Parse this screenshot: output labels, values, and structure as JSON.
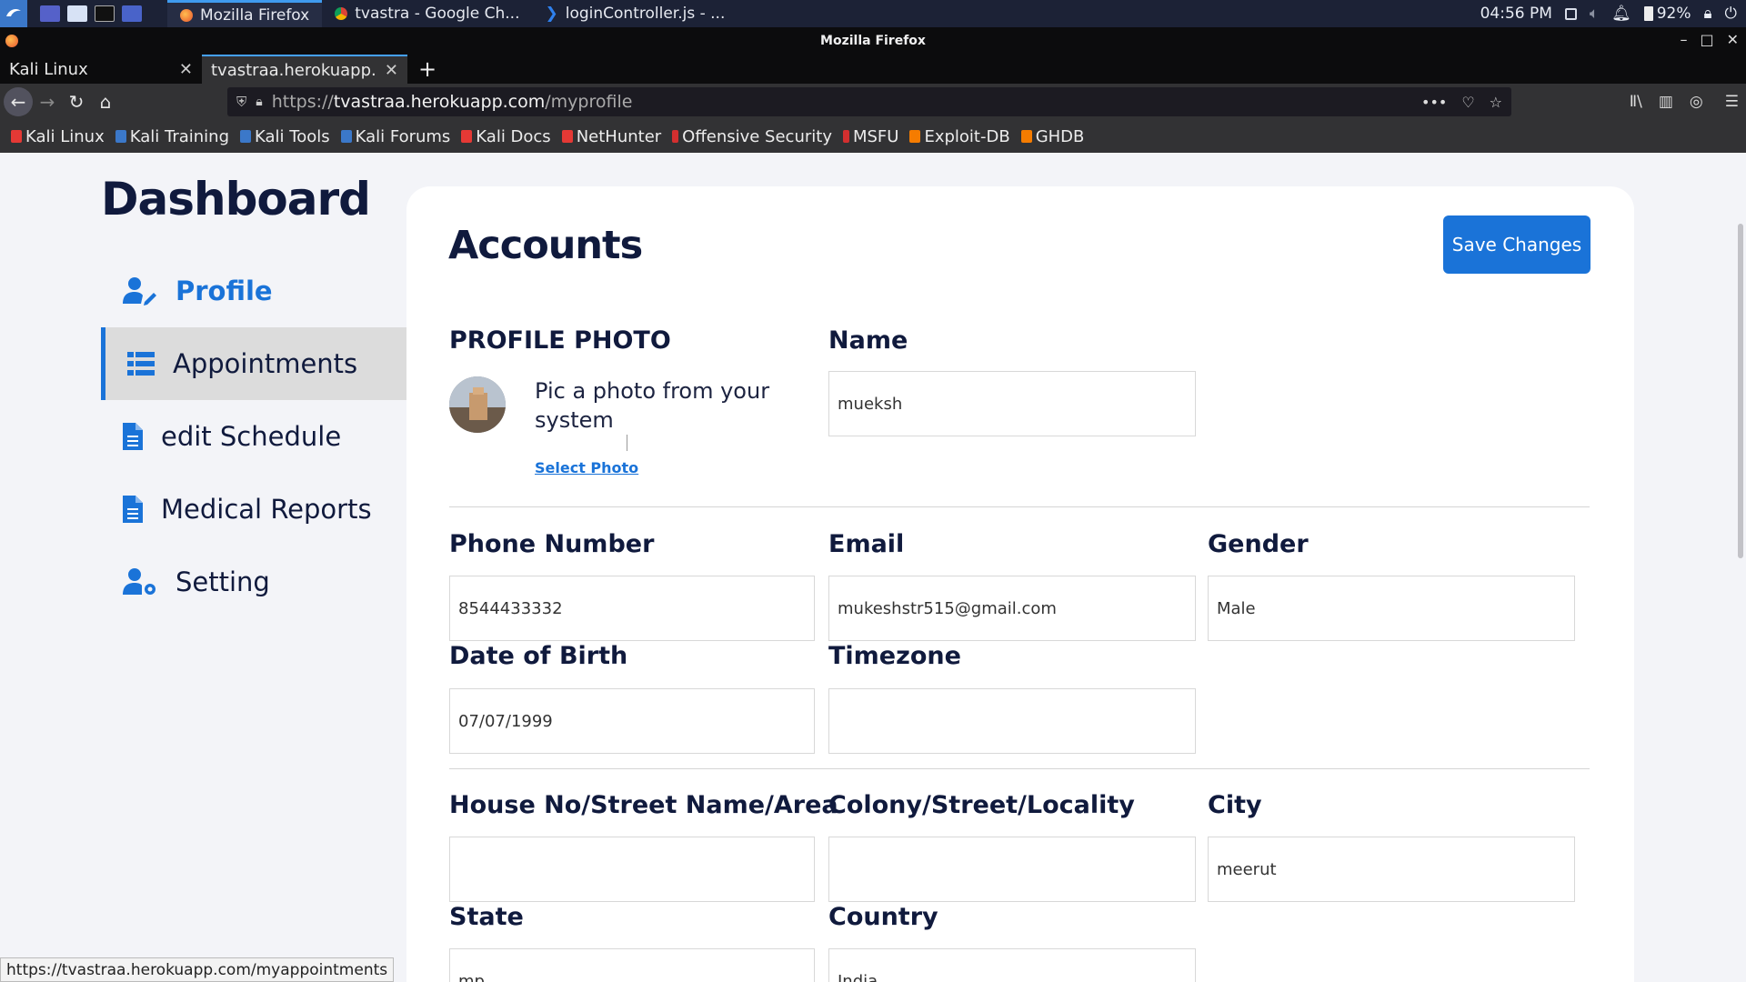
{
  "taskbar": {
    "apps": [
      {
        "label": "Mozilla Firefox",
        "icon": "firefox-icon",
        "color": "#e8542e"
      },
      {
        "label": "tvastra - Google Ch...",
        "icon": "chrome-icon",
        "color": "#f4b400"
      },
      {
        "label": "loginController.js - ...",
        "icon": "vscode-icon",
        "color": "#2f80ed"
      }
    ],
    "clock": "04:56 PM",
    "battery": "92%"
  },
  "window": {
    "title": "Mozilla Firefox"
  },
  "tabs": [
    {
      "label": "Kali Linux",
      "active": false
    },
    {
      "label": "tvastraa.herokuapp.com/myprofile",
      "active": true
    }
  ],
  "url": {
    "scheme": "https://",
    "host": "tvastraa.herokuapp.com",
    "path": "/myprofile"
  },
  "bookmarks": [
    {
      "label": "Kali Linux",
      "color": "#e53935"
    },
    {
      "label": "Kali Training",
      "color": "#3b78c9"
    },
    {
      "label": "Kali Tools",
      "color": "#3b78c9"
    },
    {
      "label": "Kali Forums",
      "color": "#3b78c9"
    },
    {
      "label": "Kali Docs",
      "color": "#e53935"
    },
    {
      "label": "NetHunter",
      "color": "#e53935"
    },
    {
      "label": "Offensive Security",
      "color": "#d32f2f"
    },
    {
      "label": "MSFU",
      "color": "#d32f2f"
    },
    {
      "label": "Exploit-DB",
      "color": "#f57c00"
    },
    {
      "label": "GHDB",
      "color": "#f57c00"
    }
  ],
  "dashboard": {
    "title": "Dashboard",
    "nav": {
      "profile": "Profile",
      "appointments": "Appointments",
      "schedule": "edit Schedule",
      "reports": "Medical Reports",
      "setting": "Setting"
    }
  },
  "accounts": {
    "title": "Accounts",
    "save_label": "Save Changes",
    "profile_photo": {
      "label": "PROFILE PHOTO",
      "prompt": "Pic a photo from your system",
      "select_label": "Select Photo"
    },
    "fields": {
      "name": {
        "label": "Name",
        "value": "mueksh"
      },
      "phone": {
        "label": "Phone Number",
        "value": "8544433332"
      },
      "email": {
        "label": "Email",
        "value": "mukeshstr515@gmail.com"
      },
      "gender": {
        "label": "Gender",
        "value": "Male"
      },
      "dob": {
        "label": "Date of Birth",
        "value": "07/07/1999"
      },
      "timezone": {
        "label": "Timezone",
        "value": ""
      },
      "house": {
        "label": "House No/Street Name/Area",
        "value": ""
      },
      "colony": {
        "label": "Colony/Street/Locality",
        "value": ""
      },
      "city": {
        "label": "City",
        "value": "meerut"
      },
      "state": {
        "label": "State",
        "value": "mp"
      },
      "country": {
        "label": "Country",
        "value": "India"
      }
    }
  },
  "status_url": "https://tvastraa.herokuapp.com/myappointments",
  "colors": {
    "accent": "#1a73d8",
    "heading": "#101a3d",
    "page_bg": "#f3f4f8"
  }
}
